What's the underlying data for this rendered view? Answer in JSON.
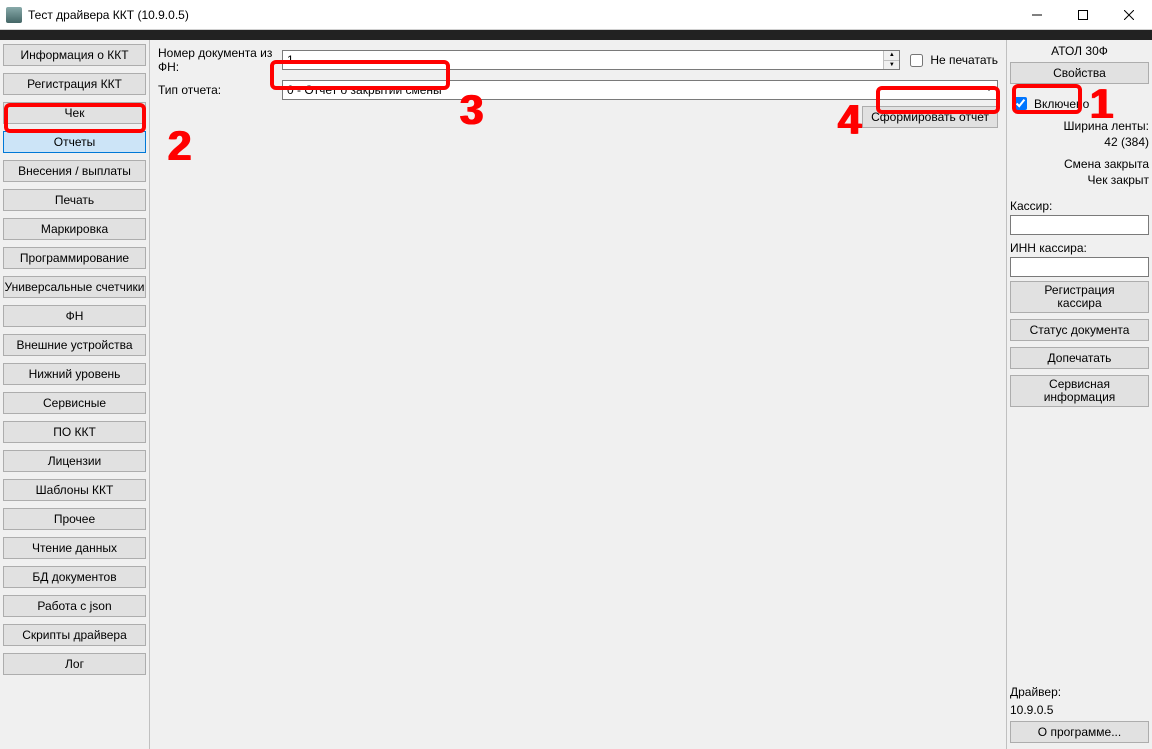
{
  "window": {
    "title": "Тест драйвера ККТ (10.9.0.5)"
  },
  "sidebar": {
    "items": [
      {
        "label": "Информация о ККТ"
      },
      {
        "label": "Регистрация ККТ"
      },
      {
        "label": "Чек"
      },
      {
        "label": "Отчеты"
      },
      {
        "label": "Внесения / выплаты"
      },
      {
        "label": "Печать"
      },
      {
        "label": "Маркировка"
      },
      {
        "label": "Программирование"
      },
      {
        "label": "Универсальные счетчики"
      },
      {
        "label": "ФН"
      },
      {
        "label": "Внешние устройства"
      },
      {
        "label": "Нижний уровень"
      },
      {
        "label": "Сервисные"
      },
      {
        "label": "ПО ККТ"
      },
      {
        "label": "Лицензии"
      },
      {
        "label": "Шаблоны ККТ"
      },
      {
        "label": "Прочее"
      },
      {
        "label": "Чтение данных"
      },
      {
        "label": "БД документов"
      },
      {
        "label": "Работа с json"
      },
      {
        "label": "Скрипты драйвера"
      },
      {
        "label": "Лог"
      }
    ],
    "selected_index": 3
  },
  "main": {
    "doc_number_label": "Номер документа из ФН:",
    "doc_number_value": "1",
    "dont_print_label": "Не печатать",
    "dont_print_checked": false,
    "report_type_label": "Тип отчета:",
    "report_type_value": "0 - Отчет о закрытии смены",
    "form_report_label": "Сформировать отчет"
  },
  "right": {
    "device_name": "АТОЛ 30Ф",
    "properties_btn": "Свойства",
    "enabled_label": "Включено",
    "enabled_checked": true,
    "tape_width_label": "Ширина ленты:",
    "tape_width_value": "42 (384)",
    "shift_status": "Смена закрыта",
    "check_status": "Чек закрыт",
    "cashier_label": "Кассир:",
    "cashier_value": "",
    "cashier_inn_label": "ИНН кассира:",
    "cashier_inn_value": "",
    "register_cashier_btn_l1": "Регистрация",
    "register_cashier_btn_l2": "кассира",
    "doc_status_btn": "Статус документа",
    "reprint_btn": "Допечатать",
    "service_info_btn_l1": "Сервисная",
    "service_info_btn_l2": "информация",
    "driver_label": "Драйвер:",
    "driver_version": "10.9.0.5",
    "about_btn": "О программе..."
  },
  "annotations": {
    "n1": "1",
    "n2": "2",
    "n3": "3",
    "n4": "4"
  }
}
